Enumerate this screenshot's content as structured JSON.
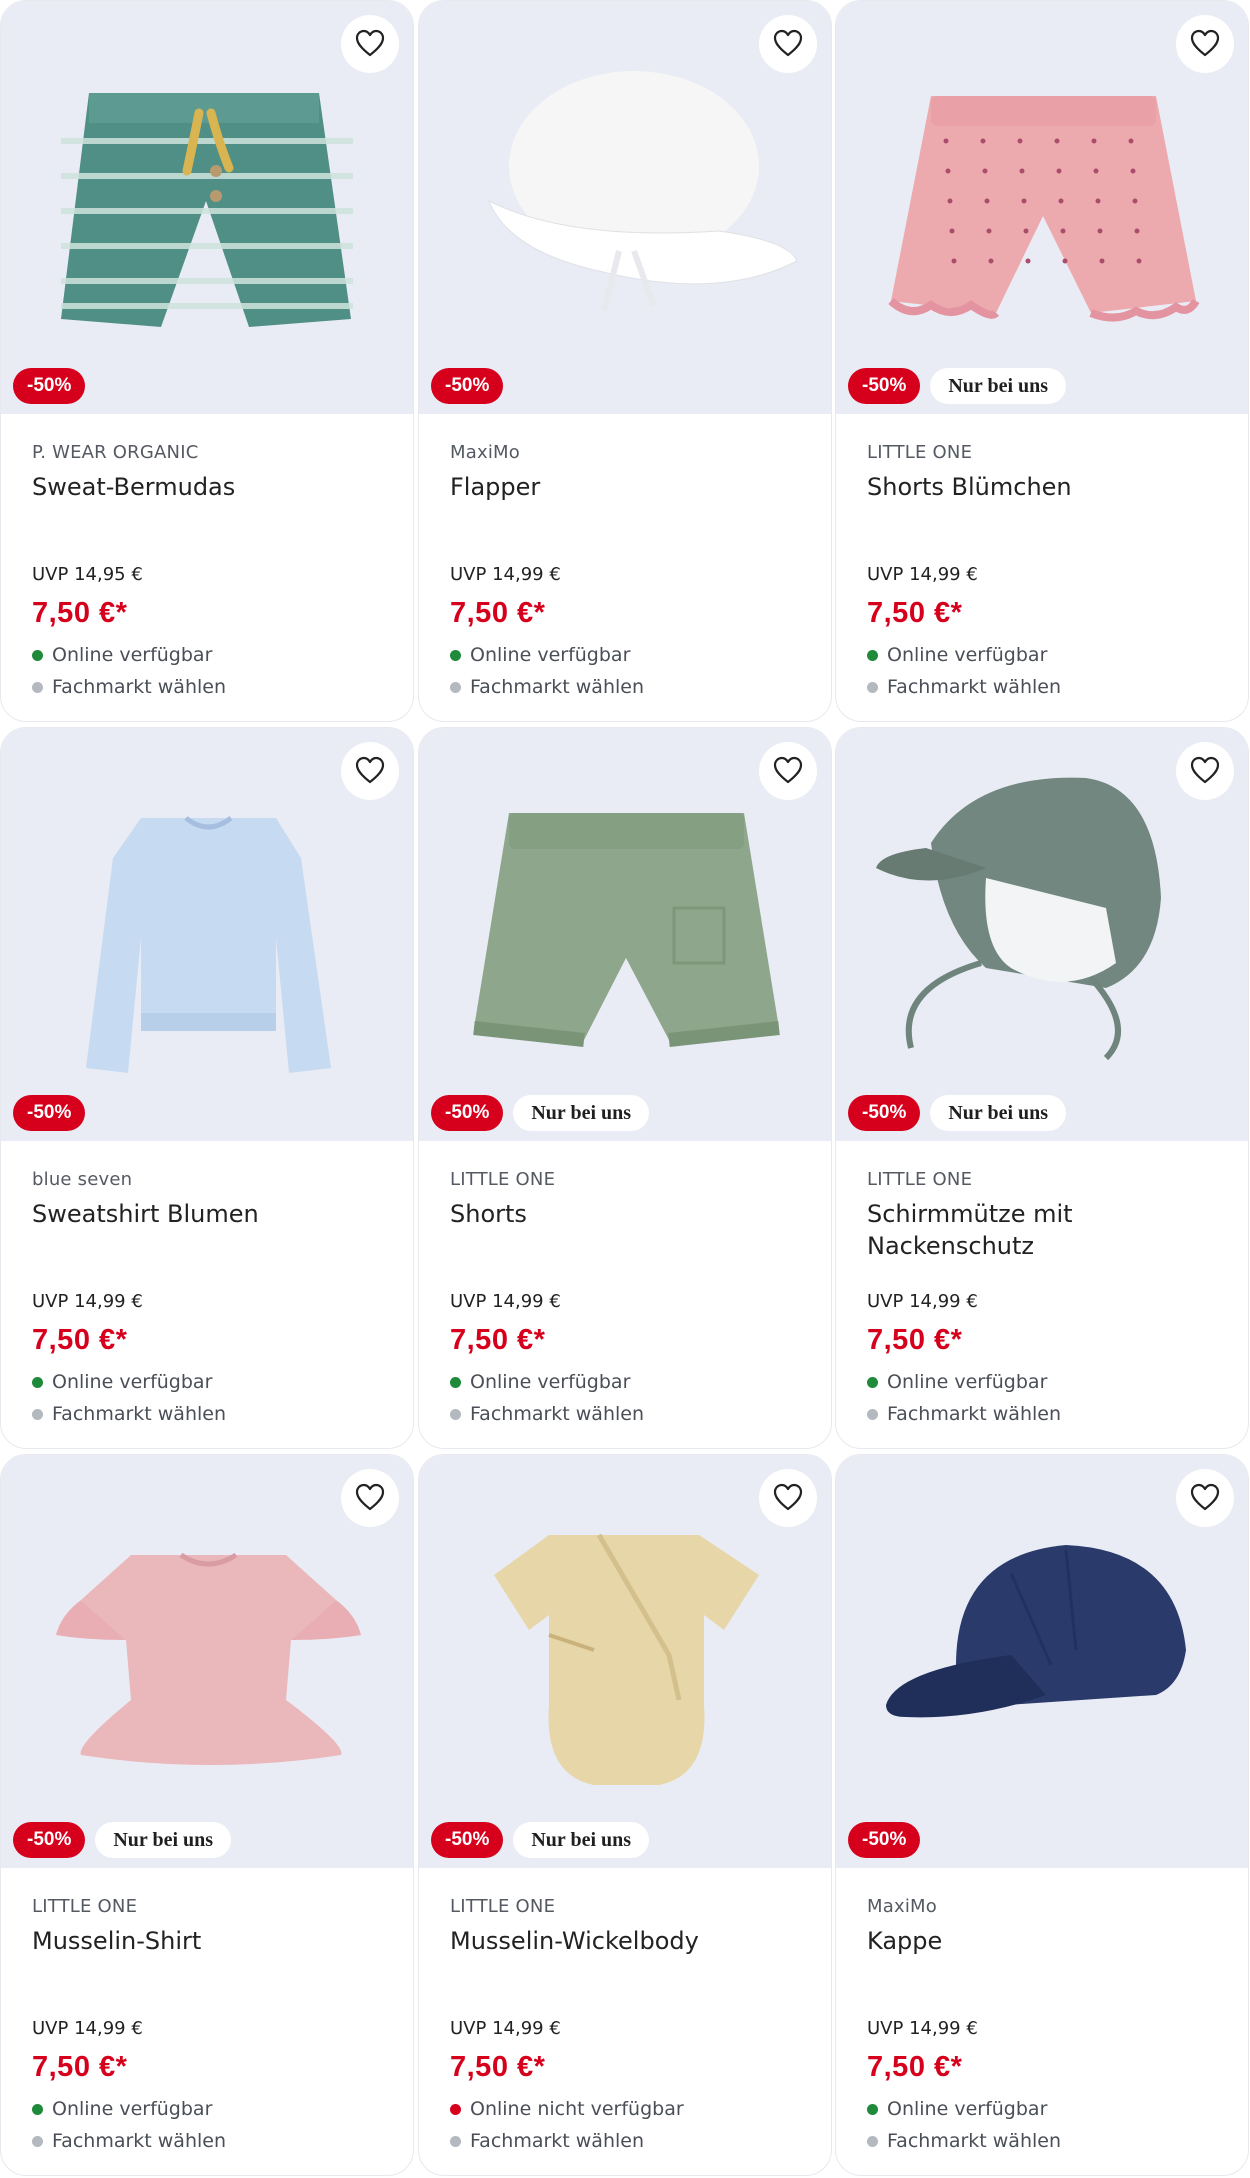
{
  "colors": {
    "sale_red": "#d6001c",
    "available_green": "#1f8a3a",
    "unavailable_red": "#d6001c",
    "store_gray": "#b4b8bf",
    "image_bg": "#e9ecf4"
  },
  "favorite_icon": "heart-outline-icon",
  "products": [
    {
      "brand": "P. WEAR ORGANIC",
      "name": "Sweat-Bermudas",
      "uvp": "UVP 14,95 €",
      "price": "7,50 €*",
      "discount": "-50%",
      "exclusive": "",
      "availability": "Online verfügbar",
      "available": true,
      "store": "Fachmarkt wählen",
      "image": "striped-shorts"
    },
    {
      "brand": "MaxiMo",
      "name": "Flapper",
      "uvp": "UVP 14,99 €",
      "price": "7,50 €*",
      "discount": "-50%",
      "exclusive": "",
      "availability": "Online verfügbar",
      "available": true,
      "store": "Fachmarkt wählen",
      "image": "white-sun-hat"
    },
    {
      "brand": "LITTLE ONE",
      "name": "Shorts Blümchen",
      "uvp": "UVP 14,99 €",
      "price": "7,50 €*",
      "discount": "-50%",
      "exclusive": "Nur bei uns",
      "availability": "Online verfügbar",
      "available": true,
      "store": "Fachmarkt wählen",
      "image": "pink-ruffle-shorts"
    },
    {
      "brand": "blue seven",
      "name": "Sweatshirt Blumen",
      "uvp": "UVP 14,99 €",
      "price": "7,50 €*",
      "discount": "-50%",
      "exclusive": "",
      "availability": "Online verfügbar",
      "available": true,
      "store": "Fachmarkt wählen",
      "image": "light-blue-sweatshirt"
    },
    {
      "brand": "LITTLE ONE",
      "name": "Shorts",
      "uvp": "UVP 14,99 €",
      "price": "7,50 €*",
      "discount": "-50%",
      "exclusive": "Nur bei uns",
      "availability": "Online verfügbar",
      "available": true,
      "store": "Fachmarkt wählen",
      "image": "green-muslin-shorts"
    },
    {
      "brand": "LITTLE ONE",
      "name": "Schirmmütze mit Nackenschutz",
      "uvp": "UVP 14,99 €",
      "price": "7,50 €*",
      "discount": "-50%",
      "exclusive": "Nur bei uns",
      "availability": "Online verfügbar",
      "available": true,
      "store": "Fachmarkt wählen",
      "image": "green-neck-flap-cap"
    },
    {
      "brand": "LITTLE ONE",
      "name": "Musselin-Shirt",
      "uvp": "UVP 14,99 €",
      "price": "7,50 €*",
      "discount": "-50%",
      "exclusive": "Nur bei uns",
      "availability": "Online verfügbar",
      "available": true,
      "store": "Fachmarkt wählen",
      "image": "pink-peplum-shirt"
    },
    {
      "brand": "LITTLE ONE",
      "name": "Musselin-Wickelbody",
      "uvp": "UVP 14,99 €",
      "price": "7,50 €*",
      "discount": "-50%",
      "exclusive": "Nur bei uns",
      "availability": "Online nicht verfügbar",
      "available": false,
      "store": "Fachmarkt wählen",
      "image": "beige-wrap-bodysuit"
    },
    {
      "brand": "MaxiMo",
      "name": "Kappe",
      "uvp": "UVP 14,99 €",
      "price": "7,50 €*",
      "discount": "-50%",
      "exclusive": "",
      "availability": "Online verfügbar",
      "available": true,
      "store": "Fachmarkt wählen",
      "image": "navy-baseball-cap"
    }
  ]
}
